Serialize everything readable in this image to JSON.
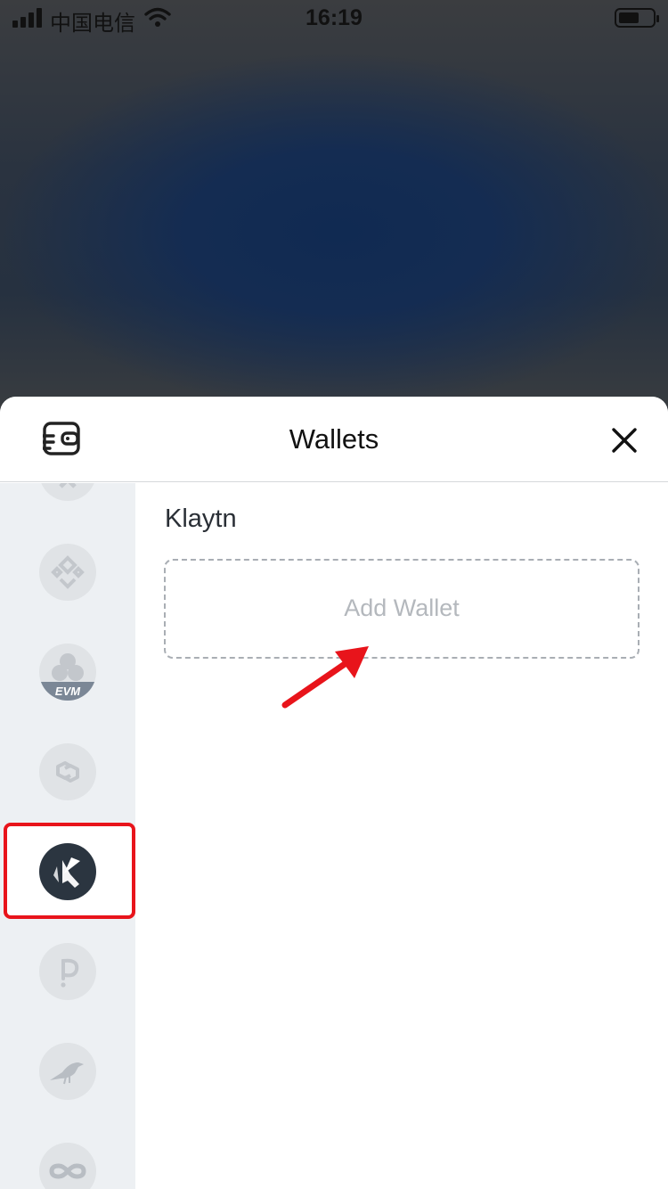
{
  "status_bar": {
    "carrier": "中国电信",
    "time": "16:19"
  },
  "sheet": {
    "title": "Wallets",
    "wallet_icon": "wallet-icon",
    "close_icon": "close-icon"
  },
  "sidebar": {
    "items": [
      {
        "icon": "chain-partial-icon",
        "active": false
      },
      {
        "icon": "bnb-chain-icon",
        "active": false
      },
      {
        "icon": "evm-icon",
        "badge": "EVM",
        "active": false
      },
      {
        "icon": "polygon-icon",
        "active": false
      },
      {
        "icon": "klaytn-icon",
        "active": true
      },
      {
        "icon": "polkadot-icon",
        "active": false
      },
      {
        "icon": "bird-chain-icon",
        "active": false
      },
      {
        "icon": "infinity-chain-icon",
        "active": false
      }
    ]
  },
  "main": {
    "chain_name": "Klaytn",
    "add_wallet_label": "Add Wallet"
  },
  "colors": {
    "accent_highlight": "#e8141b",
    "sidebar_bg": "#edf0f3",
    "active_chain": "#2b3540",
    "backdrop_blue": "#142c52"
  }
}
